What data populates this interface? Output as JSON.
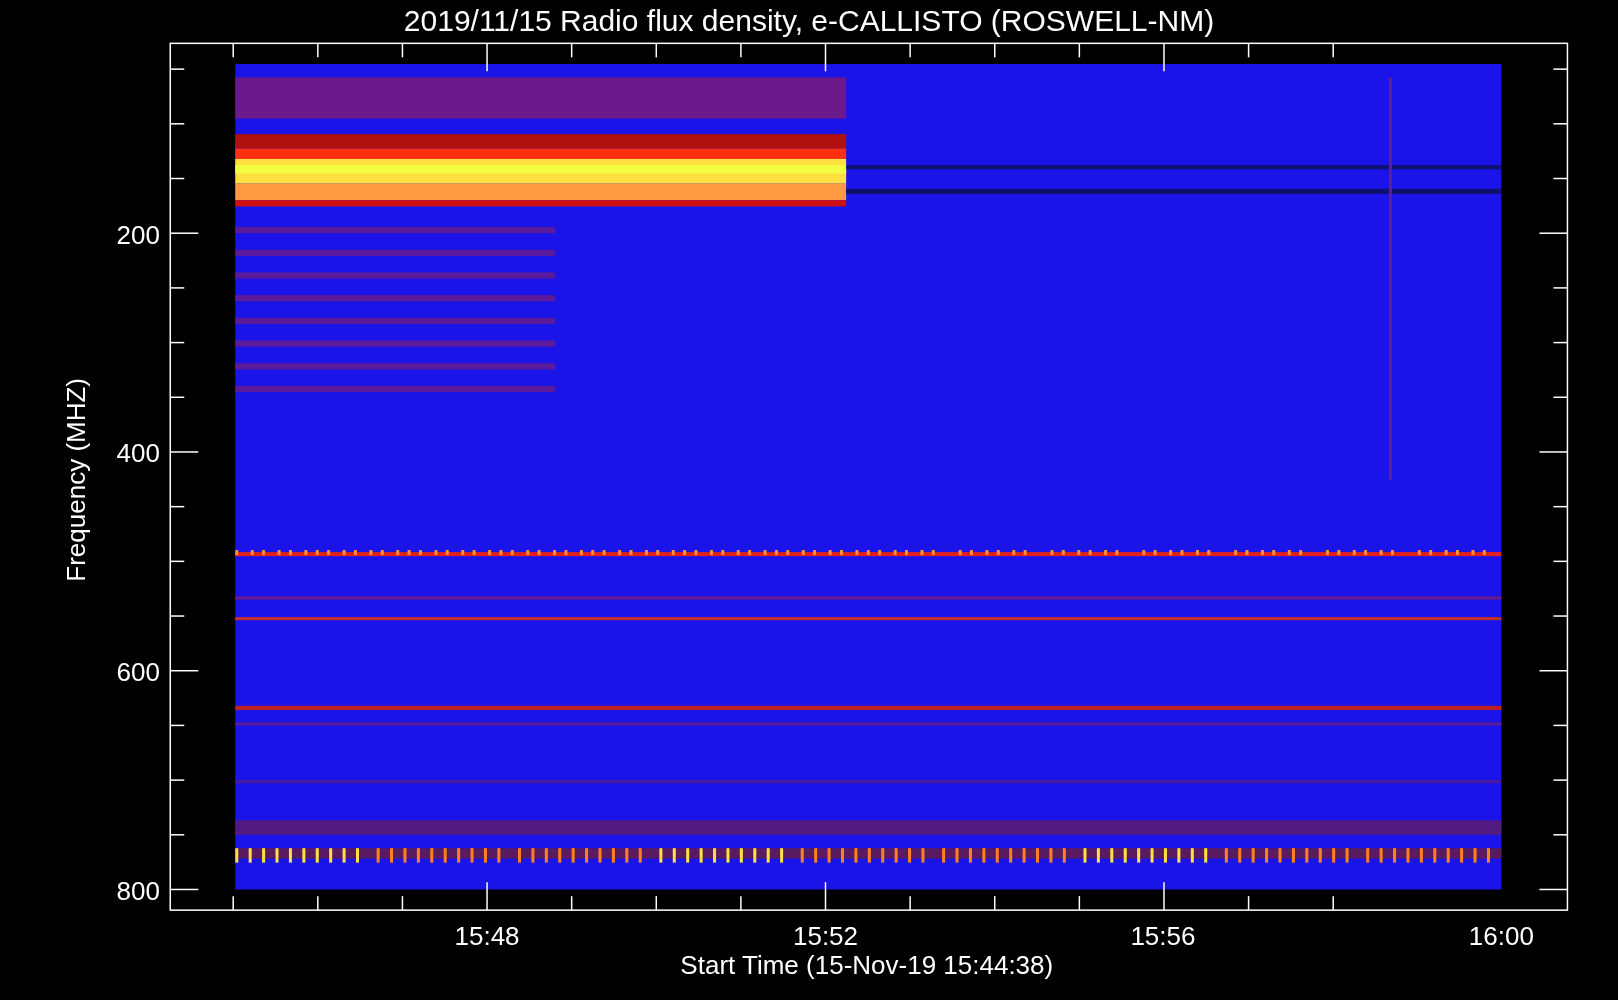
{
  "title": "2019/11/15  Radio flux density, e-CALLISTO (ROSWELL-NM)",
  "y_axis": {
    "label": "Frequency (MHZ)",
    "ticks": [
      "200",
      "400",
      "600",
      "800"
    ]
  },
  "x_axis": {
    "label": "Start Time (15-Nov-19 15:44:38)",
    "ticks": [
      "15:48",
      "15:52",
      "15:56",
      "16:00"
    ]
  }
}
